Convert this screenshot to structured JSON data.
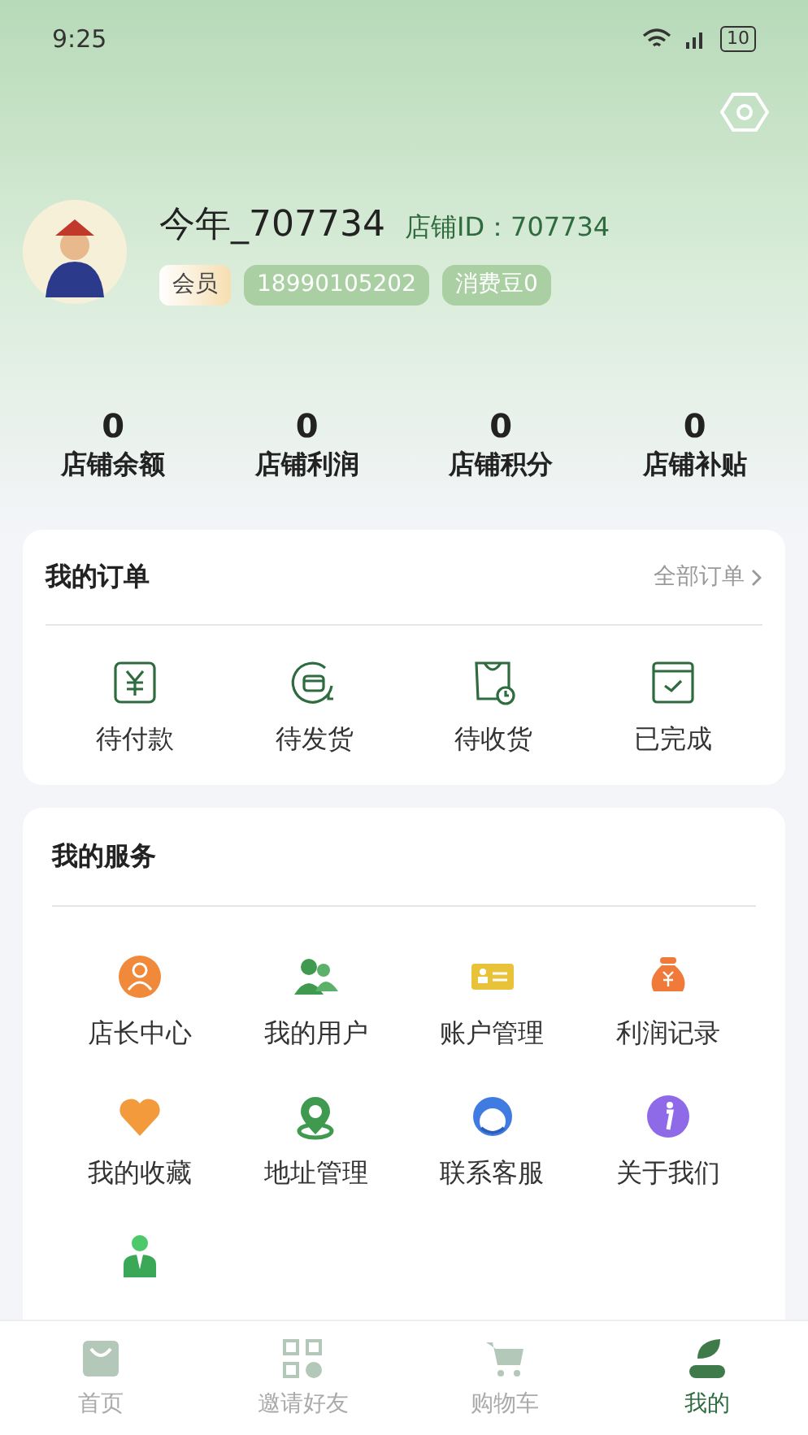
{
  "status_bar": {
    "time": "9:25",
    "battery": "10"
  },
  "profile": {
    "name": "今年_707734",
    "shop_id": "店铺ID：707734",
    "badges": [
      {
        "text": "会员",
        "kind": "member"
      },
      {
        "text": "18990105202",
        "kind": "tag"
      },
      {
        "text": "消费豆0",
        "kind": "tag"
      }
    ]
  },
  "stats": [
    {
      "value": "0",
      "label": "店铺余额"
    },
    {
      "value": "0",
      "label": "店铺利润"
    },
    {
      "value": "0",
      "label": "店铺积分"
    },
    {
      "value": "0",
      "label": "店铺补贴"
    }
  ],
  "orders": {
    "title": "我的订单",
    "link": "全部订单",
    "items": [
      {
        "label": "待付款"
      },
      {
        "label": "待发货"
      },
      {
        "label": "待收货"
      },
      {
        "label": "已完成"
      }
    ]
  },
  "services": {
    "title": "我的服务",
    "items": [
      {
        "kind": "labeled",
        "label": "店长中心"
      },
      {
        "kind": "labeled",
        "label": "我的用户"
      },
      {
        "kind": "labeled",
        "label": "账户管理"
      },
      {
        "kind": "labeled",
        "label": "利润记录"
      },
      {
        "kind": "labeled",
        "label": "我的收藏"
      },
      {
        "kind": "labeled",
        "label": "地址管理"
      },
      {
        "kind": "labeled",
        "label": "联系客服"
      },
      {
        "kind": "labeled",
        "label": "关于我们"
      },
      {
        "kind": "icon_only"
      }
    ]
  },
  "tab_bar": [
    {
      "label": "首页",
      "selected": false
    },
    {
      "label": "邀请好友",
      "selected": false
    },
    {
      "label": "购物车",
      "selected": false
    },
    {
      "label": "我的",
      "selected": true
    }
  ]
}
